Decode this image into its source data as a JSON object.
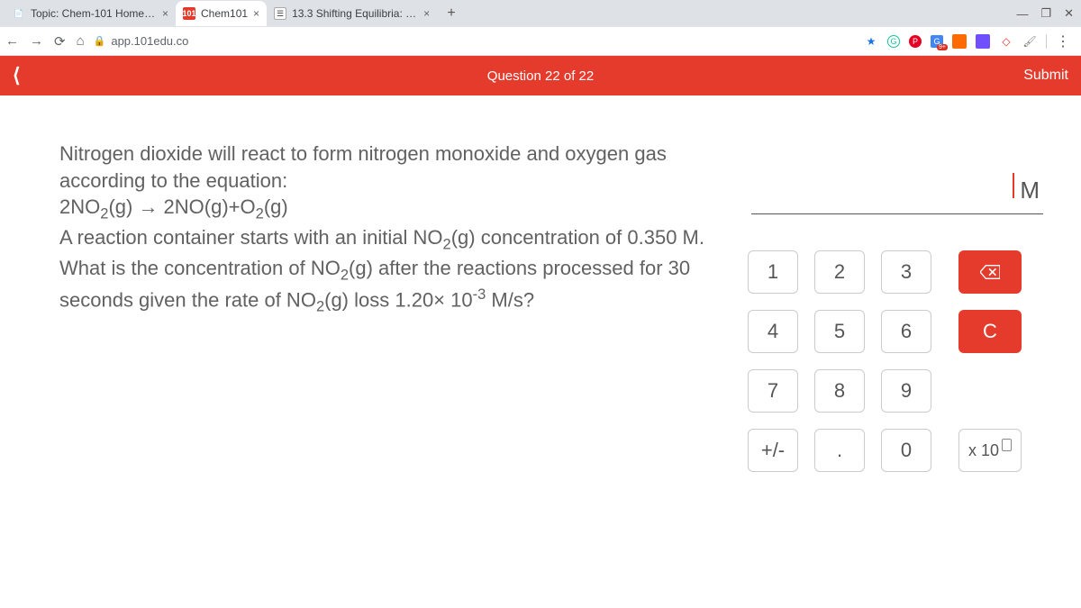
{
  "browser": {
    "tabs": [
      {
        "title": "Topic: Chem-101 Homework Qu"
      },
      {
        "title": "Chem101"
      },
      {
        "title": "13.3 Shifting Equilibria: Le Châte"
      }
    ],
    "url": "app.101edu.co"
  },
  "header": {
    "question_counter": "Question 22 of 22",
    "submit": "Submit"
  },
  "question": {
    "line1": "Nitrogen dioxide will react to form nitrogen monoxide and oxygen gas according to the equation:",
    "line3a": "A reaction container starts with an initial NO",
    "line3b": "(g) concentration of 0.350 M. What is the concentration of NO",
    "line3c": "(g) after the reactions processed for 30 seconds given the rate of NO",
    "line3d": "(g) loss 1.20× 10",
    "line3e": " M/s?",
    "equation_sub2": "2",
    "equation_sup_neg3": "-3"
  },
  "answer": {
    "unit": "M"
  },
  "keypad": {
    "k1": "1",
    "k2": "2",
    "k3": "3",
    "k4": "4",
    "k5": "5",
    "k6": "6",
    "k7": "7",
    "k8": "8",
    "k9": "9",
    "plusminus": "+/-",
    "dot": ".",
    "k0": "0",
    "clear": "C",
    "x10_label": "x 10"
  }
}
